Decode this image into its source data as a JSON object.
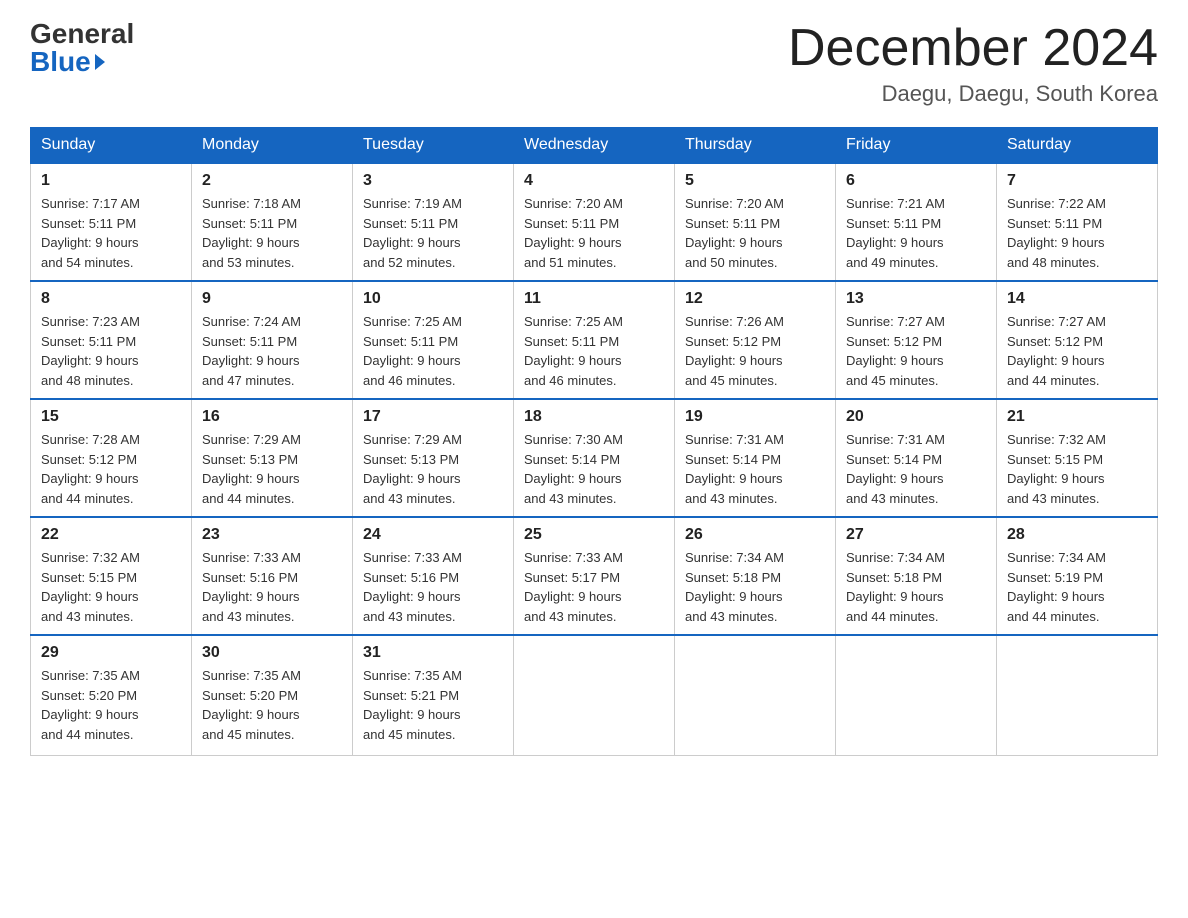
{
  "header": {
    "logo_general": "General",
    "logo_blue": "Blue",
    "month_title": "December 2024",
    "location": "Daegu, Daegu, South Korea"
  },
  "days_of_week": [
    "Sunday",
    "Monday",
    "Tuesday",
    "Wednesday",
    "Thursday",
    "Friday",
    "Saturday"
  ],
  "weeks": [
    [
      {
        "day": "1",
        "sunrise": "7:17 AM",
        "sunset": "5:11 PM",
        "daylight": "9 hours and 54 minutes."
      },
      {
        "day": "2",
        "sunrise": "7:18 AM",
        "sunset": "5:11 PM",
        "daylight": "9 hours and 53 minutes."
      },
      {
        "day": "3",
        "sunrise": "7:19 AM",
        "sunset": "5:11 PM",
        "daylight": "9 hours and 52 minutes."
      },
      {
        "day": "4",
        "sunrise": "7:20 AM",
        "sunset": "5:11 PM",
        "daylight": "9 hours and 51 minutes."
      },
      {
        "day": "5",
        "sunrise": "7:20 AM",
        "sunset": "5:11 PM",
        "daylight": "9 hours and 50 minutes."
      },
      {
        "day": "6",
        "sunrise": "7:21 AM",
        "sunset": "5:11 PM",
        "daylight": "9 hours and 49 minutes."
      },
      {
        "day": "7",
        "sunrise": "7:22 AM",
        "sunset": "5:11 PM",
        "daylight": "9 hours and 48 minutes."
      }
    ],
    [
      {
        "day": "8",
        "sunrise": "7:23 AM",
        "sunset": "5:11 PM",
        "daylight": "9 hours and 48 minutes."
      },
      {
        "day": "9",
        "sunrise": "7:24 AM",
        "sunset": "5:11 PM",
        "daylight": "9 hours and 47 minutes."
      },
      {
        "day": "10",
        "sunrise": "7:25 AM",
        "sunset": "5:11 PM",
        "daylight": "9 hours and 46 minutes."
      },
      {
        "day": "11",
        "sunrise": "7:25 AM",
        "sunset": "5:11 PM",
        "daylight": "9 hours and 46 minutes."
      },
      {
        "day": "12",
        "sunrise": "7:26 AM",
        "sunset": "5:12 PM",
        "daylight": "9 hours and 45 minutes."
      },
      {
        "day": "13",
        "sunrise": "7:27 AM",
        "sunset": "5:12 PM",
        "daylight": "9 hours and 45 minutes."
      },
      {
        "day": "14",
        "sunrise": "7:27 AM",
        "sunset": "5:12 PM",
        "daylight": "9 hours and 44 minutes."
      }
    ],
    [
      {
        "day": "15",
        "sunrise": "7:28 AM",
        "sunset": "5:12 PM",
        "daylight": "9 hours and 44 minutes."
      },
      {
        "day": "16",
        "sunrise": "7:29 AM",
        "sunset": "5:13 PM",
        "daylight": "9 hours and 44 minutes."
      },
      {
        "day": "17",
        "sunrise": "7:29 AM",
        "sunset": "5:13 PM",
        "daylight": "9 hours and 43 minutes."
      },
      {
        "day": "18",
        "sunrise": "7:30 AM",
        "sunset": "5:14 PM",
        "daylight": "9 hours and 43 minutes."
      },
      {
        "day": "19",
        "sunrise": "7:31 AM",
        "sunset": "5:14 PM",
        "daylight": "9 hours and 43 minutes."
      },
      {
        "day": "20",
        "sunrise": "7:31 AM",
        "sunset": "5:14 PM",
        "daylight": "9 hours and 43 minutes."
      },
      {
        "day": "21",
        "sunrise": "7:32 AM",
        "sunset": "5:15 PM",
        "daylight": "9 hours and 43 minutes."
      }
    ],
    [
      {
        "day": "22",
        "sunrise": "7:32 AM",
        "sunset": "5:15 PM",
        "daylight": "9 hours and 43 minutes."
      },
      {
        "day": "23",
        "sunrise": "7:33 AM",
        "sunset": "5:16 PM",
        "daylight": "9 hours and 43 minutes."
      },
      {
        "day": "24",
        "sunrise": "7:33 AM",
        "sunset": "5:16 PM",
        "daylight": "9 hours and 43 minutes."
      },
      {
        "day": "25",
        "sunrise": "7:33 AM",
        "sunset": "5:17 PM",
        "daylight": "9 hours and 43 minutes."
      },
      {
        "day": "26",
        "sunrise": "7:34 AM",
        "sunset": "5:18 PM",
        "daylight": "9 hours and 43 minutes."
      },
      {
        "day": "27",
        "sunrise": "7:34 AM",
        "sunset": "5:18 PM",
        "daylight": "9 hours and 44 minutes."
      },
      {
        "day": "28",
        "sunrise": "7:34 AM",
        "sunset": "5:19 PM",
        "daylight": "9 hours and 44 minutes."
      }
    ],
    [
      {
        "day": "29",
        "sunrise": "7:35 AM",
        "sunset": "5:20 PM",
        "daylight": "9 hours and 44 minutes."
      },
      {
        "day": "30",
        "sunrise": "7:35 AM",
        "sunset": "5:20 PM",
        "daylight": "9 hours and 45 minutes."
      },
      {
        "day": "31",
        "sunrise": "7:35 AM",
        "sunset": "5:21 PM",
        "daylight": "9 hours and 45 minutes."
      },
      null,
      null,
      null,
      null
    ]
  ],
  "labels": {
    "sunrise": "Sunrise:",
    "sunset": "Sunset:",
    "daylight": "Daylight:"
  }
}
